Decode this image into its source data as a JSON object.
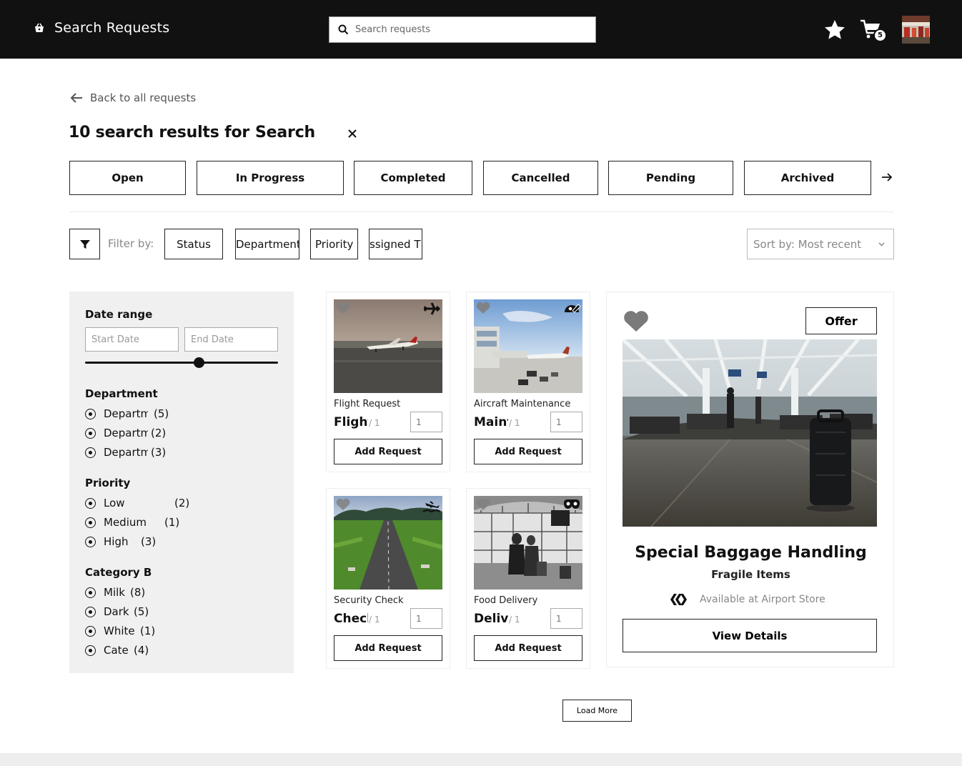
{
  "header": {
    "title": "Search Requests",
    "brand_icon": "basket-icon",
    "search_placeholder": "Search requests",
    "cart_count": "5"
  },
  "page": {
    "back_label": "Back to all requests",
    "results_prefix": "10 search results for",
    "query": "Search"
  },
  "status_tabs": [
    "Open",
    "In Progress",
    "Completed",
    "Cancelled",
    "Pending",
    "Archived"
  ],
  "filters": {
    "label": "Filter by:",
    "chips": [
      "Status",
      "Department",
      "Priority",
      "ssigned T"
    ],
    "sort_label": "Sort by: Most recent"
  },
  "sidebar": {
    "date_range": {
      "heading": "Date range",
      "start_placeholder": "Start Date",
      "end_placeholder": "End Date",
      "slider_fraction": 0.59
    },
    "department": {
      "heading": "Department",
      "options": [
        {
          "label": "Departm",
          "count": "(5)"
        },
        {
          "label": "Departm",
          "count": "(2)"
        },
        {
          "label": "Departm",
          "count": "(3)"
        }
      ]
    },
    "priority": {
      "heading": "Priority",
      "options": [
        {
          "label": "Low",
          "count": "(2)"
        },
        {
          "label": "Medium",
          "count": "(1)"
        },
        {
          "label": "High",
          "count": "(3)"
        }
      ]
    },
    "category": {
      "heading": "Category B",
      "options": [
        {
          "label": "Milk",
          "count": "(8)"
        },
        {
          "label": "Dark",
          "count": "(5)"
        },
        {
          "label": "White",
          "count": "(1)"
        },
        {
          "label": "Cate",
          "count": "(4)"
        }
      ]
    }
  },
  "cards": [
    {
      "name": "Flight Request",
      "code": "Flight",
      "per": "/ 1",
      "qty": "1",
      "button": "Add Request",
      "badge_icon": "airplane-icon"
    },
    {
      "name": "Aircraft Maintenance",
      "code": "Maint",
      "per": "/ 1",
      "qty": "1",
      "button": "Add Request",
      "badge_icon": "wrench-icon"
    },
    {
      "name": "Security Check",
      "code": "Checl",
      "per": "/ 1",
      "qty": "1",
      "button": "Add Request",
      "badge_icon": "landing-icon"
    },
    {
      "name": "Food Delivery",
      "code": "Delive",
      "per": "/ 1",
      "qty": "1",
      "button": "Add Request",
      "badge_icon": "mask-icon"
    }
  ],
  "featured": {
    "offer_label": "Offer",
    "title": "Special Baggage Handling",
    "subtitle": "Fragile Items",
    "store": "Available at Airport Store",
    "details_label": "View Details"
  },
  "load_more": "Load More",
  "colors": {
    "header_bg": "#111111",
    "sidebar_bg": "#f0f0f0",
    "muted_text": "#888888",
    "border": "#222222"
  }
}
